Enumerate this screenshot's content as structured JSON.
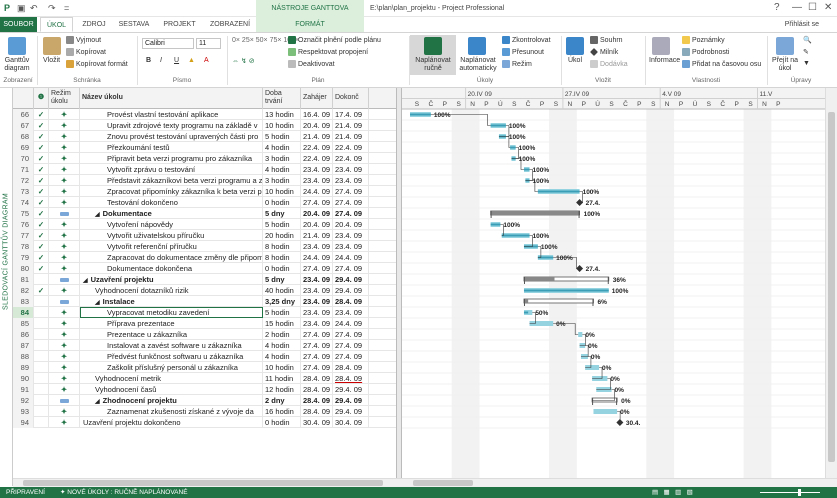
{
  "titlebar": {
    "context_label": "NÁSTROJE GANTTOVA DIAGRAMU",
    "window_title": "E:\\plan\\plan_projektu - Project Professional",
    "help": "?",
    "minimize": "—",
    "maximize": "☐",
    "close": "✕"
  },
  "tabs": {
    "file": "SOUBOR",
    "task": "ÚKOL",
    "resource": "ZDROJ",
    "report": "SESTAVA",
    "project": "PROJEKT",
    "view": "ZOBRAZENÍ",
    "format": "FORMÁT",
    "signin": "Přihlásit se"
  },
  "ribbon": {
    "view": {
      "label": "Ganttův diagram",
      "group": "Zobrazení"
    },
    "clipboard": {
      "paste": "Vložit",
      "cut": "Vyjmout",
      "copy": "Kopírovat",
      "format_painter": "Kopírovat formát",
      "group": "Schránka"
    },
    "font": {
      "name": "Calibri",
      "size": "11",
      "bold": "B",
      "italic": "I",
      "underline": "U",
      "group": "Písmo"
    },
    "schedule": {
      "mark_on_track": "Označit plnění podle plánu",
      "respect_links": "Respektovat propojení",
      "inactivate": "Deaktivovat",
      "group": "Plán"
    },
    "tasks": {
      "manual": "Naplánovat ručně",
      "auto": "Naplánovat automaticky",
      "inspect": "Zkontrolovat",
      "move": "Přesunout",
      "mode": "Režim",
      "group": "Úkoly"
    },
    "insert": {
      "task": "Úkol",
      "summary": "Souhrn",
      "milestone": "Milník",
      "deliverable": "Dodávka",
      "group": "Vložit"
    },
    "properties": {
      "information": "Informace",
      "notes": "Poznámky",
      "details": "Podrobnosti",
      "add_timeline": "Přidat na časovou osu",
      "group": "Vlastnosti"
    },
    "editing": {
      "scroll": "Přejít na úkol",
      "group": "Úpravy"
    }
  },
  "sidebar_label": "SLEDOVACÍ GANTTŮV DIAGRAM",
  "columns": {
    "info": "❶",
    "mode": "Režim úkolu",
    "name": "Název úkolu",
    "duration": "Doba trvání",
    "start": "Zahájer",
    "finish": "Dokonč"
  },
  "timescale": {
    "weeks": [
      "20.IV 09",
      "27.IV 09",
      "4.V 09",
      "11.V"
    ],
    "days": [
      "S",
      "Č",
      "P",
      "S",
      "N",
      "P",
      "Ú",
      "S",
      "Č",
      "P",
      "S",
      "N",
      "P",
      "Ú",
      "S",
      "Č",
      "P",
      "S",
      "N",
      "P",
      "Ú",
      "S",
      "Č",
      "P",
      "S",
      "N",
      "P"
    ]
  },
  "rows": [
    {
      "id": "66",
      "chk": "✓",
      "mode": "pin",
      "name": "Provést vlastní testování aplikace",
      "dur": "13 hodin",
      "start": "16.4. 09",
      "fin": "17.4. 09",
      "indent": 2
    },
    {
      "id": "67",
      "chk": "✓",
      "mode": "pin",
      "name": "Upravit zdrojové texty programu na základě v",
      "dur": "10 hodin",
      "start": "20.4. 09",
      "fin": "21.4. 09",
      "indent": 2
    },
    {
      "id": "68",
      "chk": "✓",
      "mode": "pin",
      "name": "Znovu provést testování upravených části pro",
      "dur": "5 hodin",
      "start": "21.4. 09",
      "fin": "21.4. 09",
      "indent": 2
    },
    {
      "id": "69",
      "chk": "✓",
      "mode": "pin",
      "name": "Přezkoumání testů",
      "dur": "4 hodin",
      "start": "22.4. 09",
      "fin": "22.4. 09",
      "indent": 2
    },
    {
      "id": "70",
      "chk": "✓",
      "mode": "pin",
      "name": "Připravit beta verzi programu pro zákazníka",
      "dur": "3 hodin",
      "start": "22.4. 09",
      "fin": "22.4. 09",
      "indent": 2
    },
    {
      "id": "71",
      "chk": "✓",
      "mode": "pin",
      "name": "Vytvořit zprávu o testování",
      "dur": "4 hodin",
      "start": "23.4. 09",
      "fin": "23.4. 09",
      "indent": 2
    },
    {
      "id": "72",
      "chk": "✓",
      "mode": "pin",
      "name": "Představit zákazníkovi beta verzi programu a z",
      "dur": "3 hodin",
      "start": "23.4. 09",
      "fin": "23.4. 09",
      "indent": 2
    },
    {
      "id": "73",
      "chk": "✓",
      "mode": "pin",
      "name": "Zpracovat připomínky zákazníka k beta verzi p",
      "dur": "10 hodin",
      "start": "24.4. 09",
      "fin": "27.4. 09",
      "indent": 2
    },
    {
      "id": "74",
      "chk": "✓",
      "mode": "pin",
      "name": "Testování dokončeno",
      "dur": "0 hodin",
      "start": "27.4. 09",
      "fin": "27.4. 09",
      "indent": 2
    },
    {
      "id": "75",
      "chk": "✓",
      "mode": "summary",
      "name": "Dokumentace",
      "dur": "5 dny",
      "start": "20.4. 09",
      "fin": "27.4. 09",
      "indent": 1,
      "bold": true,
      "toggle": "◢"
    },
    {
      "id": "76",
      "chk": "✓",
      "mode": "pin",
      "name": "Vytvoření nápovědy",
      "dur": "5 hodin",
      "start": "20.4. 09",
      "fin": "20.4. 09",
      "indent": 2
    },
    {
      "id": "77",
      "chk": "✓",
      "mode": "pin",
      "name": "Vytvořit uživatelskou příručku",
      "dur": "20 hodin",
      "start": "21.4. 09",
      "fin": "23.4. 09",
      "indent": 2
    },
    {
      "id": "78",
      "chk": "✓",
      "mode": "pin",
      "name": "Vytvořit referenční příručku",
      "dur": "8 hodin",
      "start": "23.4. 09",
      "fin": "23.4. 09",
      "indent": 2
    },
    {
      "id": "79",
      "chk": "✓",
      "mode": "pin",
      "name": "Zapracovat do dokumentace změny dle připom",
      "dur": "8 hodin",
      "start": "24.4. 09",
      "fin": "24.4. 09",
      "indent": 2
    },
    {
      "id": "80",
      "chk": "✓",
      "mode": "pin",
      "name": "Dokumentace dokončena",
      "dur": "0 hodin",
      "start": "27.4. 09",
      "fin": "27.4. 09",
      "indent": 2
    },
    {
      "id": "81",
      "chk": "",
      "mode": "summary",
      "name": "Uzavření projektu",
      "dur": "5 dny",
      "start": "23.4. 09",
      "fin": "29.4. 09",
      "indent": 0,
      "bold": true,
      "toggle": "◢"
    },
    {
      "id": "82",
      "chk": "✓",
      "mode": "pin",
      "name": "Vyhodnocení dotazníků rizik",
      "dur": "40 hodin",
      "start": "23.4. 09",
      "fin": "29.4. 09",
      "indent": 1
    },
    {
      "id": "83",
      "chk": "",
      "mode": "summary",
      "name": "Instalace",
      "dur": "3,25 dny",
      "start": "23.4. 09",
      "fin": "28.4. 09",
      "indent": 1,
      "bold": true,
      "toggle": "◢"
    },
    {
      "id": "84",
      "chk": "",
      "mode": "pin",
      "name": "Vypracovat metodiku zavedení",
      "dur": "5 hodin",
      "start": "23.4. 09",
      "fin": "23.4. 09",
      "indent": 2,
      "selected": true
    },
    {
      "id": "85",
      "chk": "",
      "mode": "pin",
      "name": "Příprava prezentace",
      "dur": "15 hodin",
      "start": "23.4. 09",
      "fin": "24.4. 09",
      "indent": 2
    },
    {
      "id": "86",
      "chk": "",
      "mode": "pin",
      "name": "Prezentace u zákazníka",
      "dur": "2 hodin",
      "start": "27.4. 09",
      "fin": "27.4. 09",
      "indent": 2
    },
    {
      "id": "87",
      "chk": "",
      "mode": "pin",
      "name": "Instalovat a zavést software u zákazníka",
      "dur": "4 hodin",
      "start": "27.4. 09",
      "fin": "27.4. 09",
      "indent": 2
    },
    {
      "id": "88",
      "chk": "",
      "mode": "pin",
      "name": "Předvést funkčnost softwaru u zákazníka",
      "dur": "4 hodin",
      "start": "27.4. 09",
      "fin": "27.4. 09",
      "indent": 2
    },
    {
      "id": "89",
      "chk": "",
      "mode": "pin",
      "name": "Zaškolit příslušný personál u zákazníka",
      "dur": "10 hodin",
      "start": "27.4. 09",
      "fin": "28.4. 09",
      "indent": 2
    },
    {
      "id": "90",
      "chk": "",
      "mode": "pin",
      "name": "Vyhodnocení metrik",
      "dur": "11 hodin",
      "start": "28.4. 09",
      "fin": "28.4. 09",
      "indent": 1
    },
    {
      "id": "91",
      "chk": "",
      "mode": "pin",
      "name": "Vyhodnocení časů",
      "dur": "12 hodin",
      "start": "28.4. 09",
      "fin": "29.4. 09",
      "indent": 1
    },
    {
      "id": "92",
      "chk": "",
      "mode": "summary",
      "name": "Zhodnocení projektu",
      "dur": "2 dny",
      "start": "28.4. 09",
      "fin": "29.4. 09",
      "indent": 1,
      "bold": true,
      "toggle": "◢"
    },
    {
      "id": "93",
      "chk": "",
      "mode": "pin",
      "name": "Zaznamenat zkušenosti získané z vývoje da",
      "dur": "16 hodin",
      "start": "28.4. 09",
      "fin": "29.4. 09",
      "indent": 2
    },
    {
      "id": "94",
      "chk": "",
      "mode": "pin",
      "name": "Uzavření projektu dokončeno",
      "dur": "0 hodin",
      "start": "30.4. 09",
      "fin": "30.4. 09",
      "indent": 0
    }
  ],
  "bars": [
    {
      "type": "task",
      "s": 0,
      "e": 1.5,
      "label": "100%",
      "pct": 100
    },
    {
      "type": "task",
      "s": 5.8,
      "e": 6.9,
      "label": "100%",
      "pct": 100
    },
    {
      "type": "task",
      "s": 6.4,
      "e": 6.9,
      "label": "100%",
      "pct": 100
    },
    {
      "type": "task",
      "s": 7.2,
      "e": 7.6,
      "label": "100%",
      "pct": 100
    },
    {
      "type": "task",
      "s": 7.3,
      "e": 7.6,
      "label": "100%",
      "pct": 100
    },
    {
      "type": "task",
      "s": 8.2,
      "e": 8.6,
      "label": "100%",
      "pct": 100
    },
    {
      "type": "task",
      "s": 8.3,
      "e": 8.6,
      "label": "100%",
      "pct": 100
    },
    {
      "type": "task",
      "s": 9.2,
      "e": 12.2,
      "label": "100%",
      "pct": 100
    },
    {
      "type": "milestone",
      "s": 12.2,
      "label": "27.4."
    },
    {
      "type": "summary",
      "s": 5.8,
      "e": 12.2,
      "label": "100%",
      "pct": 100
    },
    {
      "type": "task",
      "s": 5.8,
      "e": 6.5,
      "label": "100%",
      "pct": 100
    },
    {
      "type": "task",
      "s": 6.6,
      "e": 8.6,
      "label": "100%",
      "pct": 100
    },
    {
      "type": "task",
      "s": 8.2,
      "e": 9.2,
      "label": "100%",
      "pct": 100
    },
    {
      "type": "task",
      "s": 9.2,
      "e": 10.3,
      "label": "100%",
      "pct": 100
    },
    {
      "type": "milestone",
      "s": 12.2,
      "label": "27.4."
    },
    {
      "type": "summary",
      "s": 8.2,
      "e": 14.3,
      "label": "36%",
      "pct": 36
    },
    {
      "type": "task",
      "s": 8.2,
      "e": 14.3,
      "label": "100%",
      "pct": 100
    },
    {
      "type": "summary",
      "s": 8.2,
      "e": 13.2,
      "label": "6%",
      "pct": 6
    },
    {
      "type": "task",
      "s": 8.2,
      "e": 8.8,
      "label": "50%",
      "pct": 50
    },
    {
      "type": "task",
      "s": 8.6,
      "e": 10.3,
      "label": "0%",
      "pct": 0
    },
    {
      "type": "task",
      "s": 12.1,
      "e": 12.4,
      "label": "0%",
      "pct": 0
    },
    {
      "type": "task",
      "s": 12.2,
      "e": 12.6,
      "label": "0%",
      "pct": 0
    },
    {
      "type": "task",
      "s": 12.3,
      "e": 12.8,
      "label": "0%",
      "pct": 0
    },
    {
      "type": "task",
      "s": 12.6,
      "e": 13.6,
      "label": "0%",
      "pct": 0
    },
    {
      "type": "task",
      "s": 13.1,
      "e": 14.2,
      "label": "0%",
      "pct": 0
    },
    {
      "type": "task",
      "s": 13.4,
      "e": 14.5,
      "label": "0%",
      "pct": 0
    },
    {
      "type": "summary",
      "s": 13.1,
      "e": 14.9,
      "label": "0%",
      "pct": 0
    },
    {
      "type": "task",
      "s": 13.2,
      "e": 14.9,
      "label": "0%",
      "pct": 0
    },
    {
      "type": "milestone",
      "s": 15.1,
      "label": "30.4."
    }
  ],
  "status": {
    "ready": "PŘIPRAVENÍ",
    "new_tasks": "NOVÉ ÚKOLY : RUČNĚ NAPLÁNOVANÉ"
  },
  "colors": {
    "accent": "#217346",
    "bar": "#3a9fb6",
    "bar_light": "#96d3e0",
    "summary": "#555555"
  }
}
